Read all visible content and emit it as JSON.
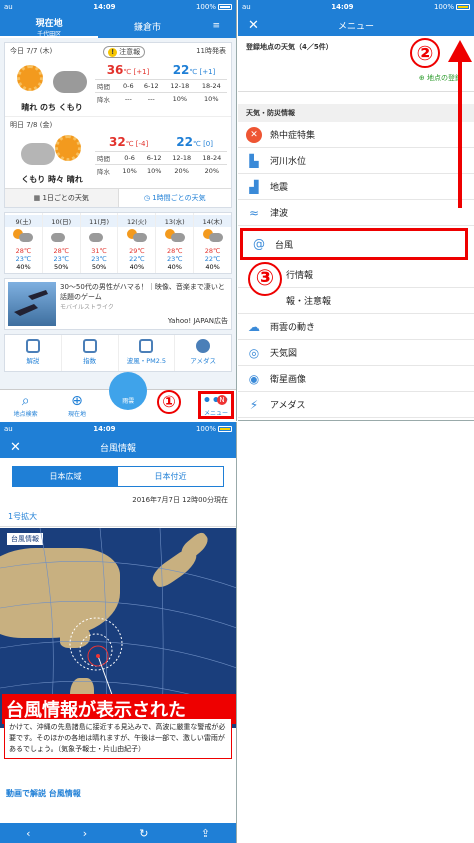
{
  "status": {
    "carrier": "au",
    "time": "14:09",
    "battery": "100%"
  },
  "home": {
    "location_tab": "現在地",
    "location_sub": "千代田区",
    "location_tab2": "鎌倉市",
    "today": {
      "date": "今日 7/7 (木)",
      "warning": "注意報",
      "issued": "11時発表",
      "label": "晴れ のち くもり",
      "high": "36",
      "high_diff": "[+1]",
      "low": "22",
      "low_diff": "[+1]",
      "time_header": [
        "時間",
        "0-6",
        "6-12",
        "12-18",
        "18-24"
      ],
      "rain": [
        "降水",
        "---",
        "---",
        "10%",
        "10%"
      ]
    },
    "tomorrow": {
      "date": "明日 7/8 (金)",
      "label": "くもり 時々 晴れ",
      "high": "32",
      "high_diff": "[-4]",
      "low": "22",
      "low_diff": "[0]",
      "time_header": [
        "時間",
        "0-6",
        "6-12",
        "12-18",
        "18-24"
      ],
      "rain": [
        "降水",
        "10%",
        "10%",
        "20%",
        "20%"
      ]
    },
    "btn_daily": "1日ごとの天気",
    "btn_hourly": "1時間ごとの天気",
    "weekly": [
      {
        "day": "9(土)",
        "hi": "28℃",
        "lo": "23℃",
        "pop": "40%"
      },
      {
        "day": "10(日)",
        "hi": "28℃",
        "lo": "23℃",
        "pop": "50%"
      },
      {
        "day": "11(月)",
        "hi": "31℃",
        "lo": "23℃",
        "pop": "50%"
      },
      {
        "day": "12(火)",
        "hi": "29℃",
        "lo": "22℃",
        "pop": "40%"
      },
      {
        "day": "13(水)",
        "hi": "28℃",
        "lo": "23℃",
        "pop": "40%"
      },
      {
        "day": "14(木)",
        "hi": "28℃",
        "lo": "22℃",
        "pop": "40%"
      }
    ],
    "ad_title": "30〜50代の男性がハマる！｜映像、音楽まで凄いと話題のゲーム",
    "ad_sponsor": "モバイルストライク",
    "ad_label": "Yahoo! JAPAN広告",
    "quick": [
      "解説",
      "指数",
      "波風・PM2.5",
      "アメダス"
    ],
    "tabbar": [
      "地点検索",
      "現在地",
      "雨雲",
      "メニュー"
    ],
    "notif_count": "N",
    "step1": "①"
  },
  "menu": {
    "title": "メニュー",
    "registered_label": "登録地点の天気（4／5件）",
    "register_link": "地点の登録",
    "section": "天気・防災情報",
    "items": [
      "熱中症特集",
      "河川水位",
      "地震",
      "津波",
      "台風",
      "行情報",
      "報・注意報",
      "雨雲の動き",
      "天気図",
      "衛星画像",
      "アメダス"
    ],
    "step2": "②",
    "step3": "③"
  },
  "typhoon": {
    "title": "台風情報",
    "tab1": "日本広域",
    "tab2": "日本付近",
    "timestamp": "2016年7月7日 12時00分現在",
    "zoom": "1号拡大",
    "map_title": "台風情報",
    "overlay": "台風情報が表示された",
    "desc": "かけて、沖縄の先島諸島に接近する見込みで、高波に厳重な警戒が必要です。そのほかの各地は晴れますが、午後は一部で、激しい雷雨があるでしょう。（気象予報士・片山由紀子）",
    "video_link": "動画で解説 台風情報"
  }
}
